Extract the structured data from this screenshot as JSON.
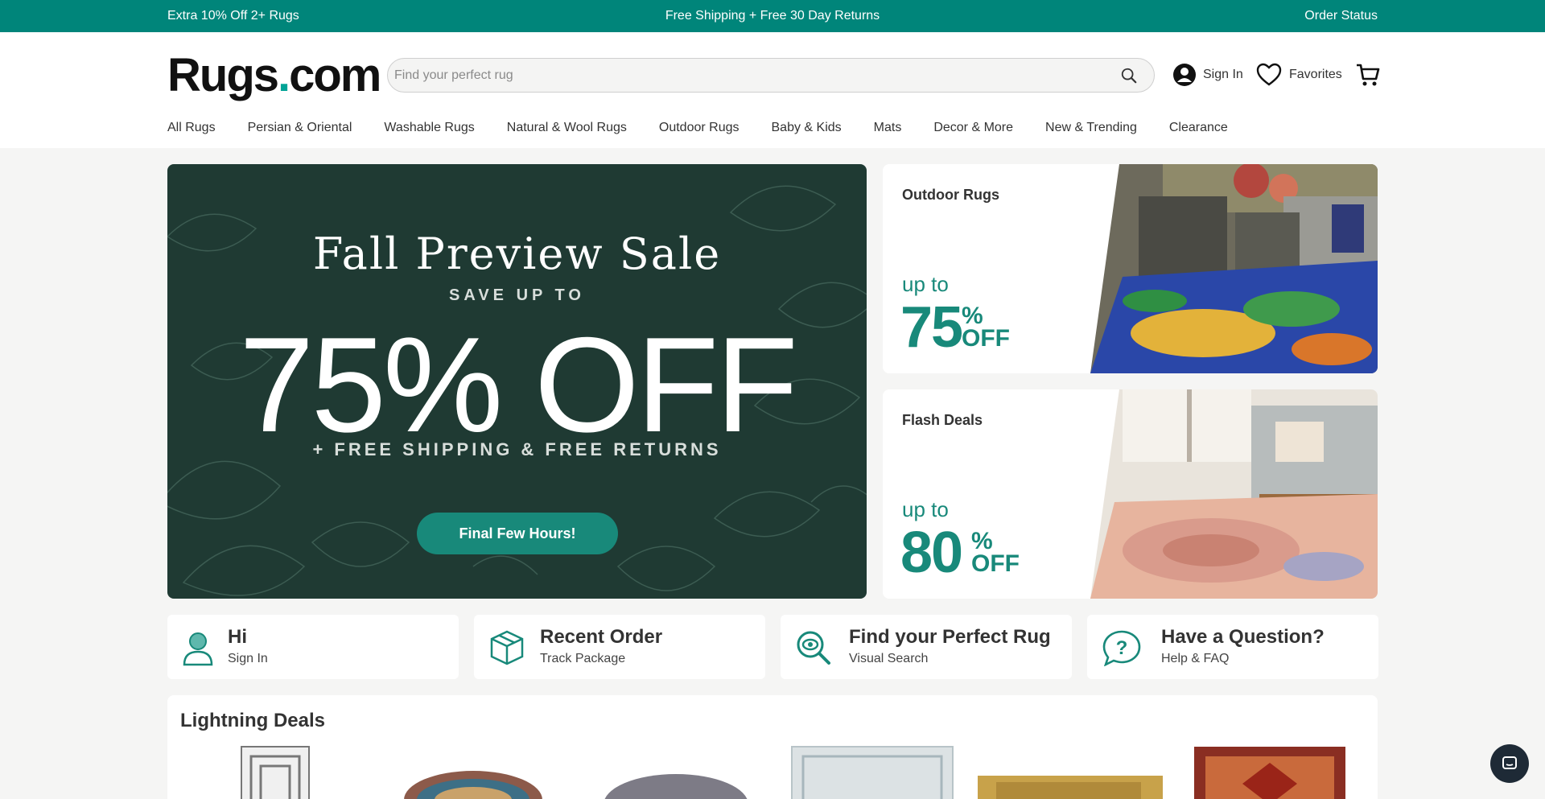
{
  "topbar": {
    "left": "Extra 10% Off 2+ Rugs",
    "center": "Free Shipping + Free 30 Day Returns",
    "right": "Order Status"
  },
  "header": {
    "logo_main": "Rugs",
    "logo_dot": ".",
    "logo_tld": "com",
    "search_placeholder": "Find your perfect rug",
    "sign_in": "Sign In",
    "favorites": "Favorites"
  },
  "nav": [
    "All Rugs",
    "Persian & Oriental",
    "Washable Rugs",
    "Natural & Wool Rugs",
    "Outdoor Rugs",
    "Baby & Kids",
    "Mats",
    "Decor & More",
    "New & Trending",
    "Clearance"
  ],
  "hero": {
    "title": "Fall Preview Sale",
    "save": "SAVE UP TO",
    "big": "75% OFF",
    "free": "+ FREE SHIPPING & FREE RETURNS",
    "button": "Final Few Hours!"
  },
  "promos": [
    {
      "title": "Outdoor Rugs",
      "upto": "up to",
      "number": "75",
      "pct": "%",
      "off": "OFF"
    },
    {
      "title": "Flash Deals",
      "upto": "up to",
      "number": "80",
      "pct": "%",
      "off": "OFF"
    }
  ],
  "cards": [
    {
      "title": "Hi",
      "sub": "Sign In",
      "icon": "user-icon"
    },
    {
      "title": "Recent Order",
      "sub": "Track Package",
      "icon": "package-icon"
    },
    {
      "title": "Find your Perfect Rug",
      "sub": "Visual Search",
      "icon": "visual-search-icon"
    },
    {
      "title": "Have a Question?",
      "sub": "Help & FAQ",
      "icon": "help-icon"
    }
  ],
  "deals": {
    "title": "Lightning Deals"
  },
  "colors": {
    "brand": "#00857a",
    "accent": "#18897a",
    "hero_bg": "#1f3a33"
  }
}
